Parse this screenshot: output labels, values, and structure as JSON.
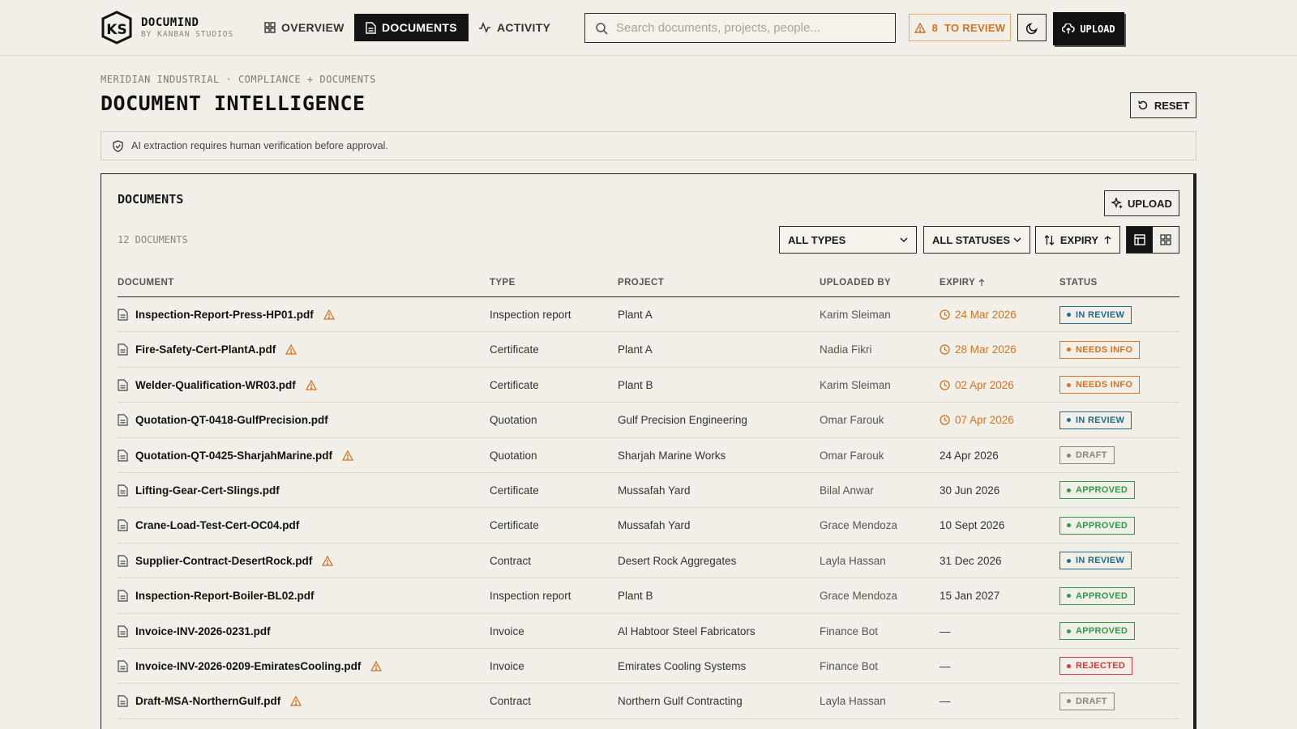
{
  "brand": {
    "name": "DOCUMIND",
    "sub": "BY KANBAN STUDIOS",
    "logo_text": "KS"
  },
  "nav": [
    {
      "label": "OVERVIEW",
      "icon": "grid-icon",
      "active": false
    },
    {
      "label": "DOCUMENTS",
      "icon": "file-icon",
      "active": true
    },
    {
      "label": "ACTIVITY",
      "icon": "activity-icon",
      "active": false
    }
  ],
  "search": {
    "placeholder": "Search documents, projects, people..."
  },
  "review": {
    "label": "8  TO REVIEW"
  },
  "upload_top": {
    "label": "UPLOAD"
  },
  "breadcrumb": "MERIDIAN INDUSTRIAL · COMPLIANCE + DOCUMENTS",
  "page_title": "DOCUMENT INTELLIGENCE",
  "reset_label": "RESET",
  "notice": "AI extraction requires human verification before approval.",
  "panel": {
    "title": "DOCUMENTS",
    "upload_label": "UPLOAD",
    "count": "12 DOCUMENTS",
    "filters": {
      "types": "ALL TYPES",
      "statuses": "ALL STATUSES",
      "sort": "EXPIRY"
    }
  },
  "table": {
    "headers": [
      "DOCUMENT",
      "TYPE",
      "PROJECT",
      "UPLOADED BY",
      "EXPIRY",
      "STATUS"
    ],
    "rows": [
      {
        "document": "Inspection-Report-Press-HP01.pdf",
        "flag": true,
        "type": "Inspection report",
        "project": "Plant A",
        "uploaded_by": "Karim Sleiman",
        "expiry": "24 Mar 2026",
        "expiry_warn": true,
        "status": "IN REVIEW"
      },
      {
        "document": "Fire-Safety-Cert-PlantA.pdf",
        "flag": true,
        "type": "Certificate",
        "project": "Plant A",
        "uploaded_by": "Nadia Fikri",
        "expiry": "28 Mar 2026",
        "expiry_warn": true,
        "status": "NEEDS INFO"
      },
      {
        "document": "Welder-Qualification-WR03.pdf",
        "flag": true,
        "type": "Certificate",
        "project": "Plant B",
        "uploaded_by": "Karim Sleiman",
        "expiry": "02 Apr 2026",
        "expiry_warn": true,
        "status": "NEEDS INFO"
      },
      {
        "document": "Quotation-QT-0418-GulfPrecision.pdf",
        "flag": false,
        "type": "Quotation",
        "project": "Gulf Precision Engineering",
        "uploaded_by": "Omar Farouk",
        "expiry": "07 Apr 2026",
        "expiry_warn": true,
        "status": "IN REVIEW"
      },
      {
        "document": "Quotation-QT-0425-SharjahMarine.pdf",
        "flag": true,
        "type": "Quotation",
        "project": "Sharjah Marine Works",
        "uploaded_by": "Omar Farouk",
        "expiry": "24 Apr 2026",
        "expiry_warn": false,
        "status": "DRAFT"
      },
      {
        "document": "Lifting-Gear-Cert-Slings.pdf",
        "flag": false,
        "type": "Certificate",
        "project": "Mussafah Yard",
        "uploaded_by": "Bilal Anwar",
        "expiry": "30 Jun 2026",
        "expiry_warn": false,
        "status": "APPROVED"
      },
      {
        "document": "Crane-Load-Test-Cert-OC04.pdf",
        "flag": false,
        "type": "Certificate",
        "project": "Mussafah Yard",
        "uploaded_by": "Grace Mendoza",
        "expiry": "10 Sept 2026",
        "expiry_warn": false,
        "status": "APPROVED"
      },
      {
        "document": "Supplier-Contract-DesertRock.pdf",
        "flag": true,
        "type": "Contract",
        "project": "Desert Rock Aggregates",
        "uploaded_by": "Layla Hassan",
        "expiry": "31 Dec 2026",
        "expiry_warn": false,
        "status": "IN REVIEW"
      },
      {
        "document": "Inspection-Report-Boiler-BL02.pdf",
        "flag": false,
        "type": "Inspection report",
        "project": "Plant B",
        "uploaded_by": "Grace Mendoza",
        "expiry": "15 Jan 2027",
        "expiry_warn": false,
        "status": "APPROVED"
      },
      {
        "document": "Invoice-INV-2026-0231.pdf",
        "flag": false,
        "type": "Invoice",
        "project": "Al Habtoor Steel Fabricators",
        "uploaded_by": "Finance Bot",
        "expiry": "—",
        "expiry_warn": false,
        "status": "APPROVED"
      },
      {
        "document": "Invoice-INV-2026-0209-EmiratesCooling.pdf",
        "flag": true,
        "type": "Invoice",
        "project": "Emirates Cooling Systems",
        "uploaded_by": "Finance Bot",
        "expiry": "—",
        "expiry_warn": false,
        "status": "REJECTED"
      },
      {
        "document": "Draft-MSA-NorthernGulf.pdf",
        "flag": true,
        "type": "Contract",
        "project": "Northern Gulf Contracting",
        "uploaded_by": "Layla Hassan",
        "expiry": "—",
        "expiry_warn": false,
        "status": "DRAFT"
      }
    ]
  },
  "status_colors": {
    "IN REVIEW": "#1f6b8a",
    "NEEDS INFO": "#d5731f",
    "DRAFT": "#8a867d",
    "APPROVED": "#2f9a47",
    "REJECTED": "#d23a3a"
  },
  "colors": {
    "accent": "#141414",
    "warning": "#d5731f",
    "background": "#f2efe8"
  }
}
